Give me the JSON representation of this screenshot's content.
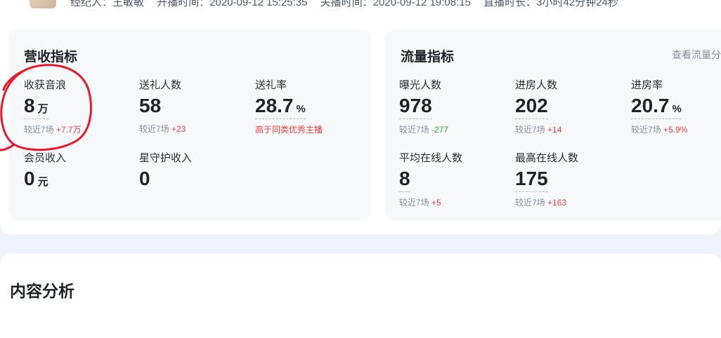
{
  "header": {
    "items": [
      "经纪人：王敏敏",
      "开播时间：2020-09-12 15:25:35",
      "关播时间：2020-09-12 19:08:15",
      "直播时长：3小时42分钟24秒"
    ]
  },
  "revenue": {
    "title": "营收指标",
    "metrics": [
      {
        "label": "收获音浪",
        "value": "8",
        "unit": "万",
        "compare_prefix": "较近7场",
        "compare_value": "+7.7万"
      },
      {
        "label": "送礼人数",
        "value": "58",
        "unit": "",
        "compare_prefix": "较近7场",
        "compare_value": "+23"
      },
      {
        "label": "送礼率",
        "value": "28.7",
        "unit": "%",
        "compare_prefix": "高于",
        "compare_value": "同类优秀主播"
      },
      {
        "label": "会员收入",
        "value": "0",
        "unit": "元"
      },
      {
        "label": "星守护收入",
        "value": "0",
        "unit": ""
      }
    ]
  },
  "traffic": {
    "title": "流量指标",
    "link": "查看流量分",
    "metrics": [
      {
        "label": "曝光人数",
        "value": "978",
        "unit": "",
        "compare_prefix": "较近7场",
        "compare_value": "-277"
      },
      {
        "label": "进房人数",
        "value": "202",
        "unit": "",
        "compare_prefix": "较近7场",
        "compare_value": "+14"
      },
      {
        "label": "进房率",
        "value": "20.7",
        "unit": "%",
        "compare_prefix": "较近7场",
        "compare_value": "+5.9%"
      },
      {
        "label": "平均在线人数",
        "value": "8",
        "unit": "",
        "compare_prefix": "较近7场",
        "compare_value": "+5"
      },
      {
        "label": "最高在线人数",
        "value": "175",
        "unit": "",
        "compare_prefix": "较近7场",
        "compare_value": "+163"
      }
    ]
  },
  "content": {
    "title": "内容分析"
  },
  "colors": {
    "increase": "#f53f3f",
    "decrease": "#2ba82b",
    "annotation": "#e8192c"
  }
}
